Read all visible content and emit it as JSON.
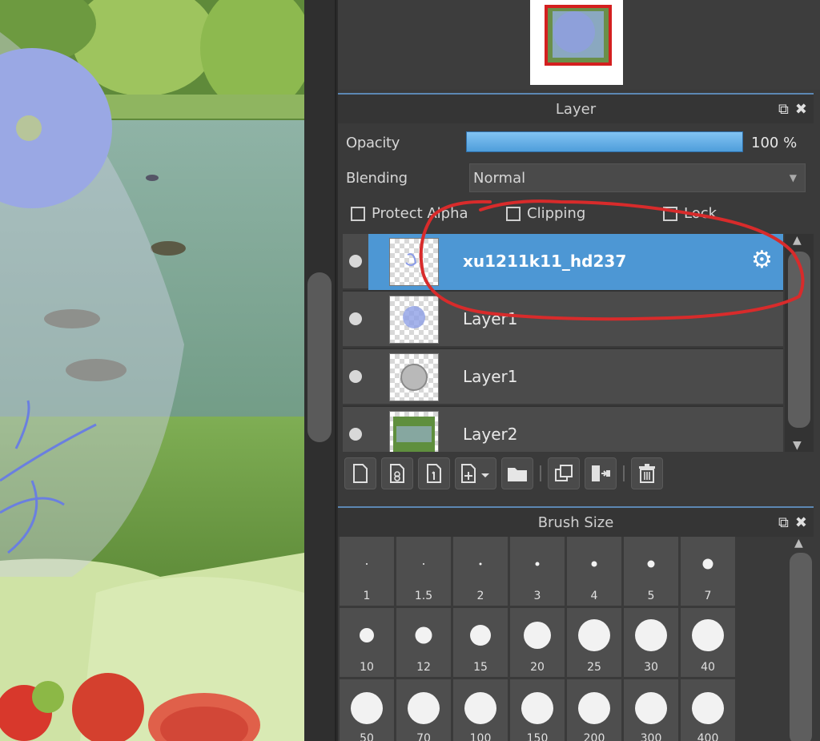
{
  "layer_panel": {
    "title": "Layer",
    "opacity_label": "Opacity",
    "opacity_value": "100 %",
    "opacity_fraction": 1.0,
    "blending_label": "Blending",
    "blending_value": "Normal",
    "protect_alpha_label": "Protect Alpha",
    "clipping_label": "Clipping",
    "lock_label": "Lock",
    "layers": [
      {
        "name": "xu1211k11_hd237",
        "selected": true
      },
      {
        "name": "Layer1",
        "selected": false
      },
      {
        "name": "Layer1",
        "selected": false
      },
      {
        "name": "Layer2",
        "selected": false
      }
    ]
  },
  "brush_panel": {
    "title": "Brush Size",
    "sizes": [
      "1",
      "1.5",
      "2",
      "3",
      "4",
      "5",
      "7",
      "10",
      "12",
      "15",
      "20",
      "25",
      "30",
      "40",
      "50",
      "70",
      "100",
      "150",
      "200",
      "300",
      "400"
    ]
  },
  "colors": {
    "selection": "#4d97d4",
    "opacity_bar": "#6bb3ea",
    "annotation": "#d82b2b"
  }
}
